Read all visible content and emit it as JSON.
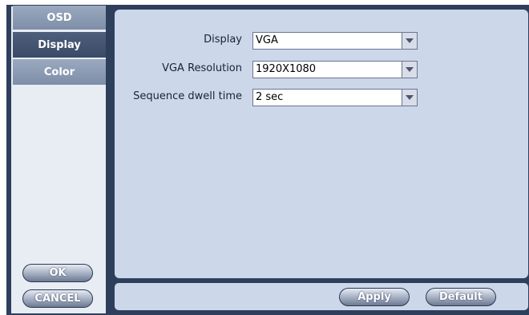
{
  "sidebar": {
    "tabs": [
      {
        "label": "OSD",
        "active": false
      },
      {
        "label": "Display",
        "active": true
      },
      {
        "label": "Color",
        "active": false
      }
    ],
    "ok_label": "OK",
    "cancel_label": "CANCEL"
  },
  "settings": {
    "display": {
      "label": "Display",
      "value": "VGA"
    },
    "vga_resolution": {
      "label": "VGA Resolution",
      "value": "1920X1080"
    },
    "sequence_dwell": {
      "label": "Sequence dwell time",
      "value": "2 sec"
    }
  },
  "footer": {
    "apply_label": "Apply",
    "default_label": "Default"
  },
  "colors": {
    "frame": "#2e3f5c",
    "panel": "#cdd7ea",
    "active_tab": "#3a4a66",
    "inactive_tab": "#8a9ab3"
  }
}
